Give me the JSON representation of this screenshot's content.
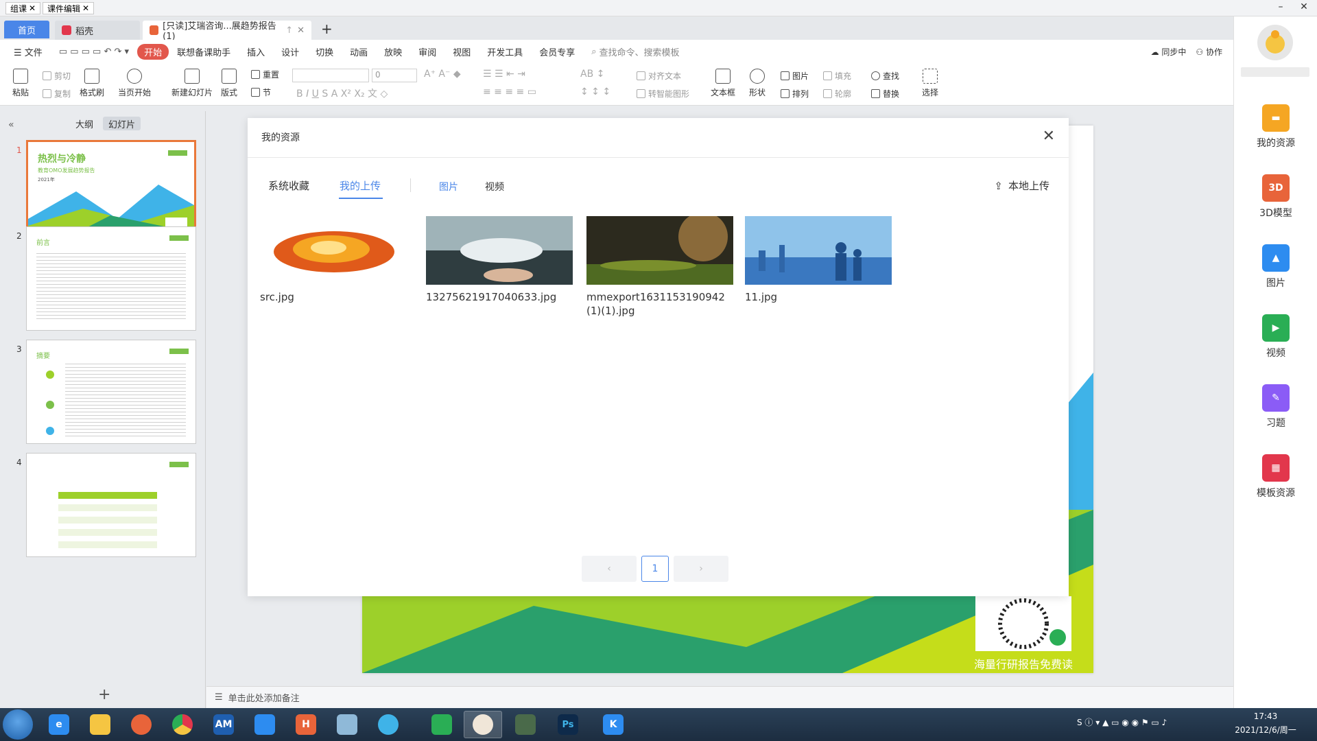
{
  "top_tabs": [
    {
      "label": "组课"
    },
    {
      "label": "课件编辑"
    }
  ],
  "window_controls": {
    "minimize": "–",
    "maximize": "□",
    "close": "✕"
  },
  "doc_tabs": {
    "home": "首页",
    "docer": "稻壳",
    "active_doc": "[只读]艾瑞咨询...展趋势报告(1)",
    "new_tab": "+"
  },
  "menu": {
    "file": "文件",
    "items": [
      "开始",
      "联想备课助手",
      "插入",
      "设计",
      "切换",
      "动画",
      "放映",
      "审阅",
      "视图",
      "开发工具",
      "会员专享"
    ],
    "search": "查找命令、搜索模板",
    "sync": "同步中",
    "collab": "协作"
  },
  "ribbon": {
    "paste": "粘贴",
    "cut": "剪切",
    "copy": "复制",
    "format_painter": "格式刷",
    "from_current": "当页开始",
    "new_slide": "新建幻灯片",
    "layout": "版式",
    "reset": "重置",
    "section": "节",
    "font_size": "0",
    "align_text": "对齐文本",
    "smartart": "转智能图形",
    "textbox": "文本框",
    "shape": "形状",
    "picture": "图片",
    "arrange": "排列",
    "fill": "填充",
    "outline": "轮廓",
    "find": "查找",
    "replace": "替换",
    "select": "选择"
  },
  "left_panel": {
    "outline_tab": "大纲",
    "slides_tab": "幻灯片",
    "slides": [
      {
        "num": "1",
        "title": "热烈与冷静",
        "subtitle": "教育OMO发展趋势报告",
        "year": "2021年"
      },
      {
        "num": "2",
        "title": "前言"
      },
      {
        "num": "3",
        "title": "摘要"
      },
      {
        "num": "4",
        "title": ""
      }
    ],
    "add": "+"
  },
  "notes_placeholder": "单击此处添加备注",
  "slide_footer": "海量行研报告免费读",
  "modal": {
    "title": "我的资源",
    "tabs": [
      "系统收藏",
      "我的上传"
    ],
    "filters": [
      "图片",
      "视频"
    ],
    "upload": "本地上传",
    "assets": [
      {
        "name": "src.jpg"
      },
      {
        "name": "13275621917040633.jpg"
      },
      {
        "name": "mmexport1631153190942(1)(1).jpg"
      },
      {
        "name": "11.jpg"
      }
    ],
    "pager": {
      "prev": "‹",
      "page": "1",
      "next": "›"
    }
  },
  "right_sidebar": {
    "items": [
      {
        "label": "我的资源",
        "color": "#f5a623"
      },
      {
        "label": "3D模型",
        "color": "#e8643a"
      },
      {
        "label": "图片",
        "color": "#2d8cf0"
      },
      {
        "label": "视频",
        "color": "#2aae55"
      },
      {
        "label": "习题",
        "color": "#8b5cf6"
      },
      {
        "label": "模板资源",
        "color": "#e2374c"
      }
    ]
  },
  "taskbar": {
    "apps": [
      "AM",
      "H"
    ],
    "time": "17:43",
    "date": "2021/12/6/周一"
  },
  "colors": {
    "accent": "#4a86e8",
    "wps_red": "#e2574c",
    "selected_slide": "#e9783a"
  }
}
